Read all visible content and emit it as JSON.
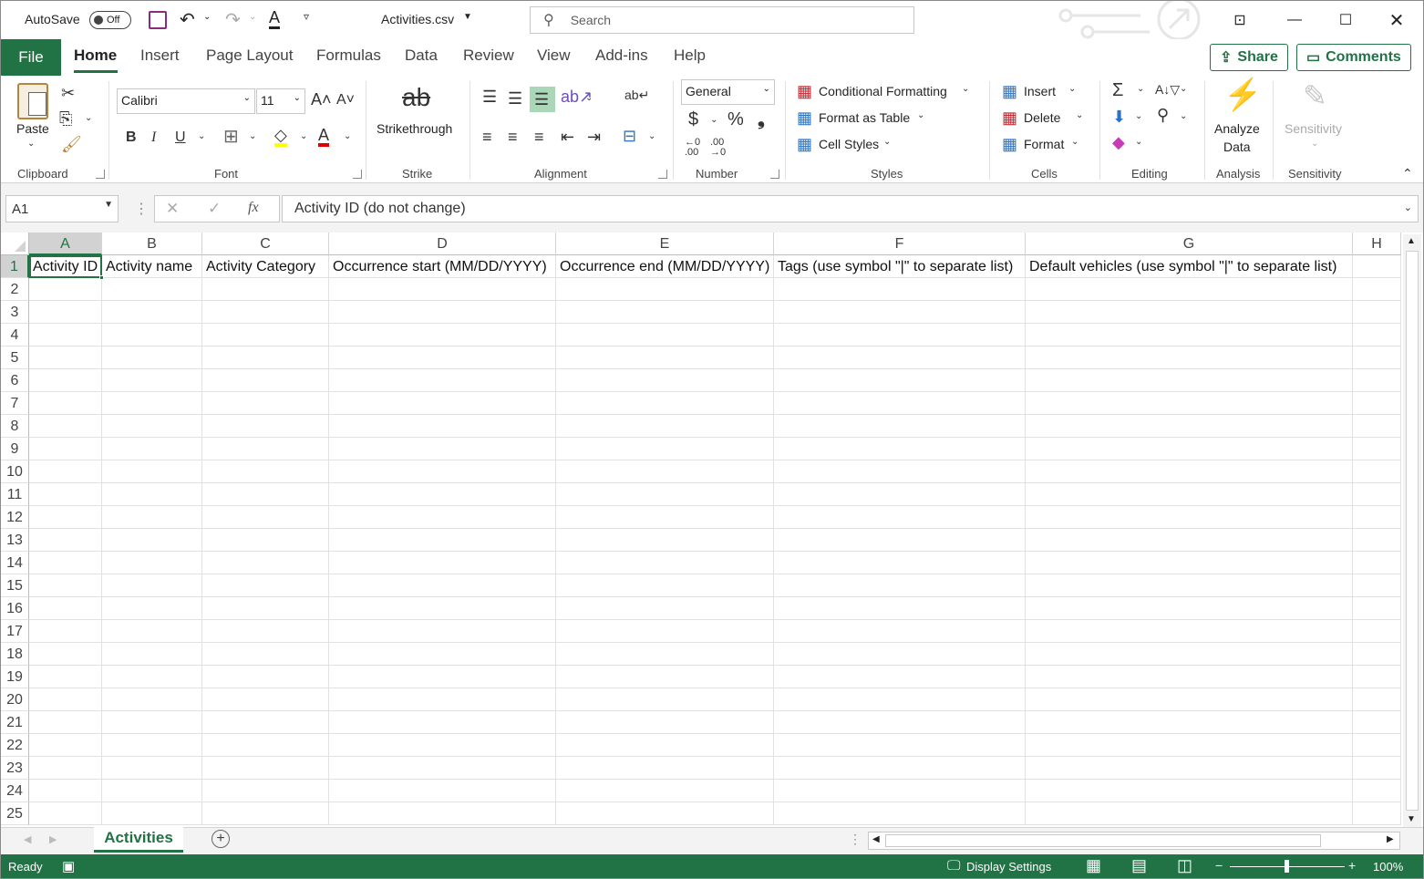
{
  "title_bar": {
    "autosave_label": "AutoSave",
    "autosave_state": "Off",
    "file_name": "Activities.csv",
    "search_placeholder": "Search"
  },
  "tabs": {
    "file": "File",
    "home": "Home",
    "insert": "Insert",
    "page_layout": "Page Layout",
    "formulas": "Formulas",
    "data": "Data",
    "review": "Review",
    "view": "View",
    "addins": "Add-ins",
    "help": "Help",
    "share": "Share",
    "comments": "Comments"
  },
  "ribbon": {
    "clipboard": {
      "paste": "Paste",
      "label": "Clipboard"
    },
    "font": {
      "name": "Calibri",
      "size": "11",
      "label": "Font"
    },
    "strike": {
      "button": "Strikethrough",
      "label": "Strike"
    },
    "alignment": {
      "label": "Alignment"
    },
    "number": {
      "format": "General",
      "label": "Number"
    },
    "styles": {
      "conditional": "Conditional Formatting",
      "format_table": "Format as Table",
      "cell_styles": "Cell Styles",
      "label": "Styles"
    },
    "cells": {
      "insert": "Insert",
      "delete": "Delete",
      "format": "Format",
      "label": "Cells"
    },
    "editing": {
      "label": "Editing"
    },
    "analysis": {
      "button_line1": "Analyze",
      "button_line2": "Data",
      "label": "Analysis"
    },
    "sensitivity": {
      "button": "Sensitivity",
      "label": "Sensitivity"
    }
  },
  "formula_bar": {
    "name_box": "A1",
    "fx": "fx",
    "formula": "Activity ID (do not change)"
  },
  "sheet": {
    "columns": [
      "A",
      "B",
      "C",
      "D",
      "E",
      "F",
      "G",
      "H"
    ],
    "header_row": [
      "Activity ID",
      "Activity name",
      "Activity Category",
      "Occurrence start (MM/DD/YYYY)",
      "Occurrence end (MM/DD/YYYY)",
      "Tags (use symbol \"|\" to separate list)",
      "Default vehicles (use symbol \"|\" to separate list)",
      ""
    ],
    "rows": [
      "1",
      "2",
      "3",
      "4",
      "5",
      "6",
      "7",
      "8",
      "9",
      "10",
      "11",
      "12",
      "13",
      "14",
      "15",
      "16",
      "17",
      "18",
      "19",
      "20",
      "21",
      "22",
      "23",
      "24",
      "25"
    ]
  },
  "sheet_tabs": {
    "active": "Activities"
  },
  "status_bar": {
    "ready": "Ready",
    "display_settings": "Display Settings",
    "zoom": "100%"
  },
  "colors": {
    "accent": "#217346",
    "status": "#217346"
  }
}
